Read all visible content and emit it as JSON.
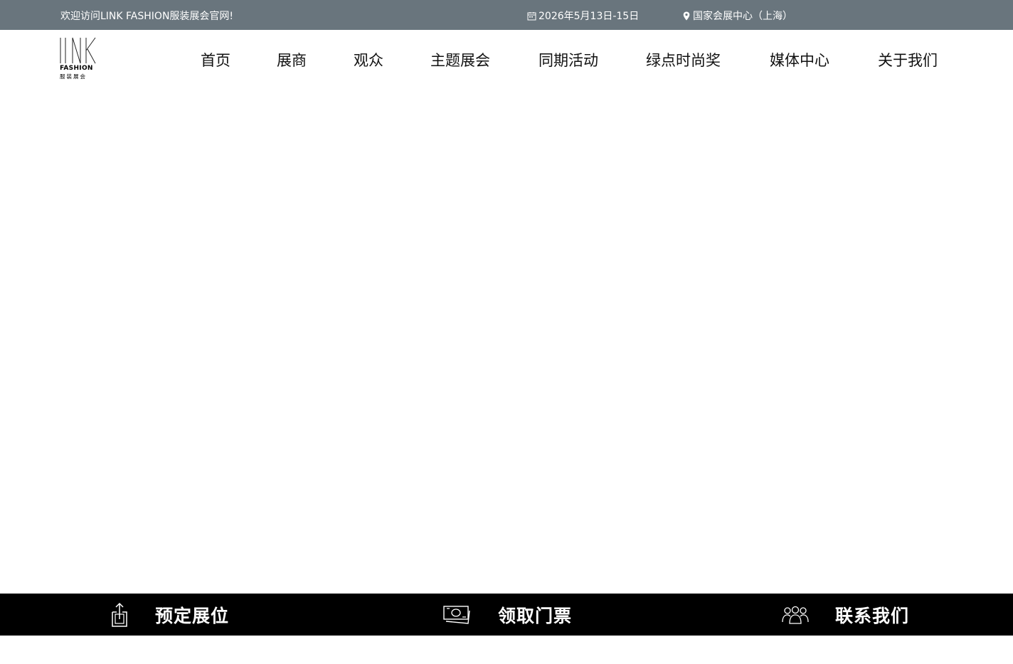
{
  "topbar": {
    "welcome": "欢迎访问LINK FASHION服装展会官网!",
    "date": "2026年5月13日-15日",
    "venue": "国家会展中心（上海）",
    "background": "#69757d"
  },
  "logo": {
    "brand": "FASHION",
    "subtitle": "服装展会",
    "mark": "LINK"
  },
  "nav": {
    "items": [
      {
        "label": "首页"
      },
      {
        "label": "展商"
      },
      {
        "label": "观众"
      },
      {
        "label": "主题展会"
      },
      {
        "label": "同期活动"
      },
      {
        "label": "绿点时尚奖"
      },
      {
        "label": "媒体中心"
      },
      {
        "label": "关于我们"
      }
    ]
  },
  "bottom_bar": {
    "background": "#000000",
    "items": [
      {
        "label": "预定展位",
        "icon": "share-upload-icon"
      },
      {
        "label": "领取门票",
        "icon": "ticket-money-icon"
      },
      {
        "label": "联系我们",
        "icon": "people-group-icon"
      }
    ]
  }
}
